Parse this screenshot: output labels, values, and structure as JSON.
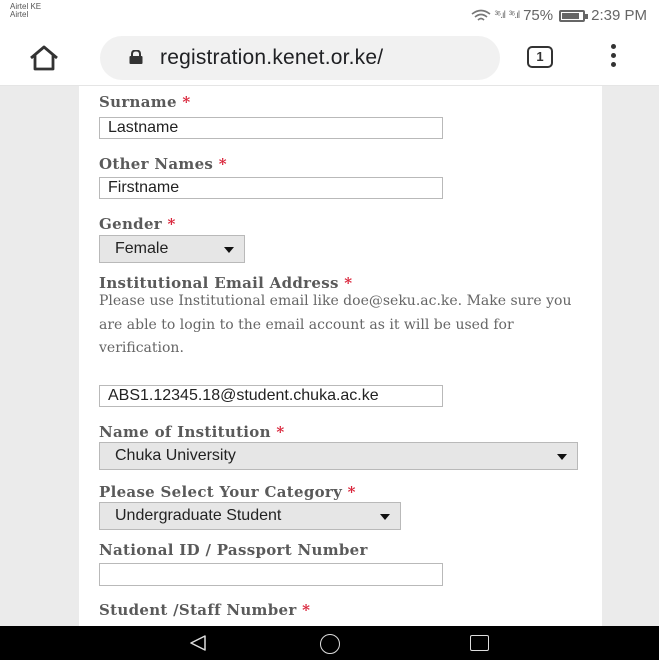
{
  "status_bar": {
    "carrier_1": "Airtel KE",
    "carrier_2": "Airtel",
    "signal_1": "³⁶.ıl",
    "signal_2": "³⁶.ıl",
    "battery_percent": "75%",
    "battery_level": 0.75,
    "time": "2:39 PM"
  },
  "browser": {
    "url": "registration.kenet.or.ke/",
    "tab_count": "1"
  },
  "form": {
    "surname": {
      "label": "Surname",
      "required": "*",
      "value": "Lastname"
    },
    "other_names": {
      "label": "Other Names",
      "required": "*",
      "value": "Firstname"
    },
    "gender": {
      "label": "Gender",
      "required": "*",
      "selected": "Female"
    },
    "email": {
      "label": "Institutional Email Address",
      "required": "*",
      "help": "Please use Institutional email like doe@seku.ac.ke. Make sure you are able to login to the email account as it will be used for verification.",
      "value": "ABS1.12345.18@student.chuka.ac.ke"
    },
    "institution": {
      "label": "Name of Institution",
      "required": "*",
      "selected": "Chuka University"
    },
    "category": {
      "label": "Please Select Your Category",
      "required": "*",
      "selected": "Undergraduate Student"
    },
    "national_id": {
      "label": "National ID / Passport Number",
      "value": ""
    },
    "staff_number": {
      "label": "Student /Staff Number",
      "required": "*"
    }
  },
  "icons": {
    "home": "home-icon",
    "lock": "lock-icon",
    "menu": "more-vert-icon",
    "back": "nav-back-icon",
    "nav_home": "nav-home-icon",
    "recents": "nav-recents-icon"
  },
  "colors": {
    "required": "#d9243a",
    "page_background": "#ebebeb"
  }
}
